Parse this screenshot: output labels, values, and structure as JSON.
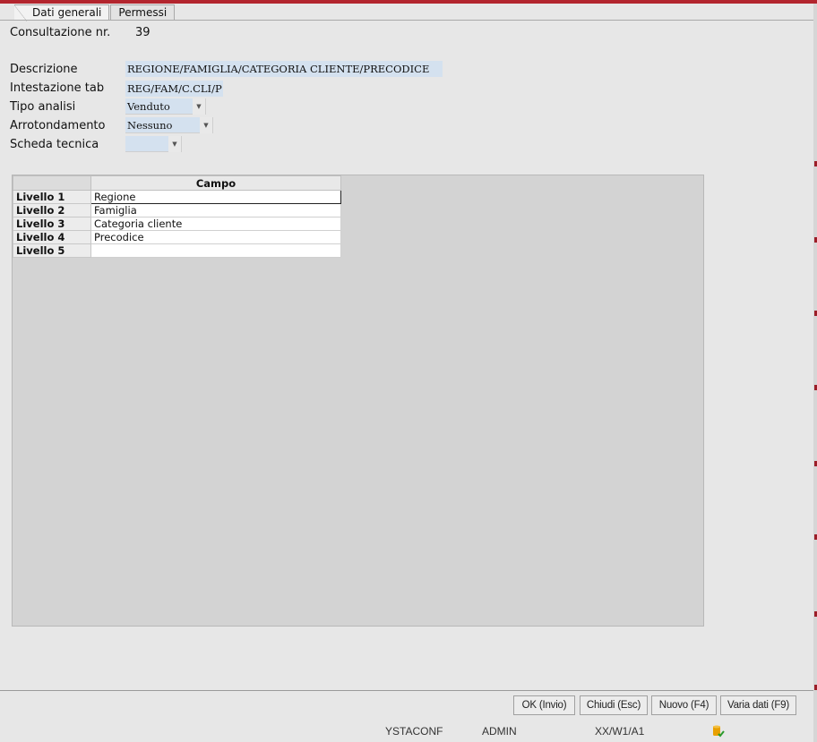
{
  "tabs": [
    {
      "label": "Dati generali",
      "active": true
    },
    {
      "label": "Permessi",
      "active": false
    }
  ],
  "form": {
    "consultazione": {
      "label": "Consultazione nr.",
      "value": "39"
    },
    "descrizione": {
      "label": "Descrizione",
      "value": "REGIONE/FAMIGLIA/CATEGORIA CLIENTE/PRECODICE"
    },
    "intestazione": {
      "label": "Intestazione tab",
      "value": "REG/FAM/C.CLI/P"
    },
    "tipo_analisi": {
      "label": "Tipo analisi",
      "value": "Venduto"
    },
    "arrotondamento": {
      "label": "Arrotondamento",
      "value": "Nessuno"
    },
    "scheda_tecnica": {
      "label": "Scheda tecnica",
      "value": ""
    }
  },
  "grid": {
    "column_header": "Campo",
    "rows": [
      {
        "label": "Livello 1",
        "value": "Regione"
      },
      {
        "label": "Livello 2",
        "value": "Famiglia"
      },
      {
        "label": "Livello 3",
        "value": "Categoria cliente"
      },
      {
        "label": "Livello 4",
        "value": "Precodice"
      },
      {
        "label": "Livello 5",
        "value": ""
      }
    ]
  },
  "buttons": {
    "ok": "OK (Invio)",
    "chiudi": "Chiudi (Esc)",
    "nuovo": "Nuovo (F4)",
    "varia": "Varia dati (F9)"
  },
  "status": {
    "program": "YSTACONF",
    "user": "ADMIN",
    "session": "XX/W1/A1"
  },
  "colors": {
    "accent": "#b3252e",
    "field_bg": "#d4e1ef",
    "status_icon": "#e8a000"
  }
}
